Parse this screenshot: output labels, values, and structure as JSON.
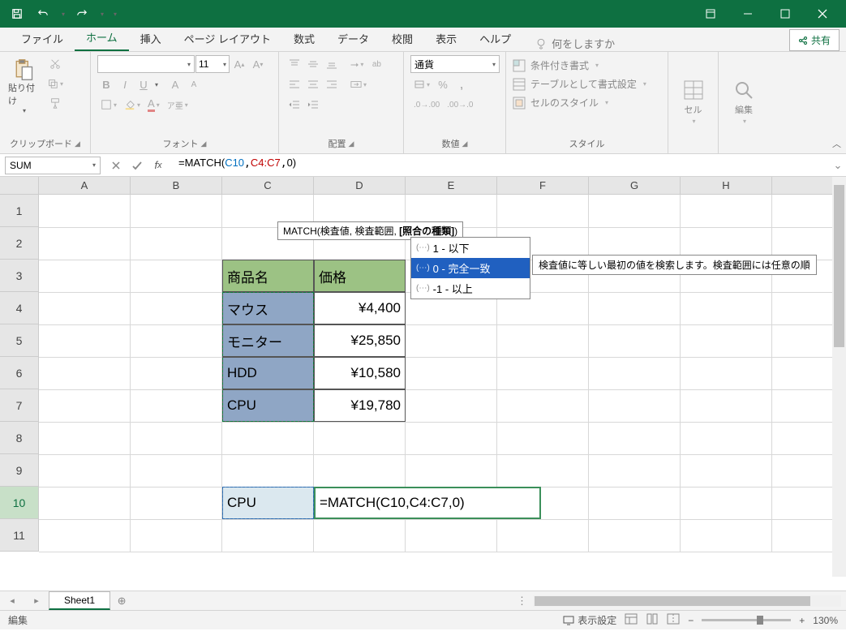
{
  "titlebar": {
    "save": "save",
    "undo": "undo",
    "redo": "redo"
  },
  "tabs": {
    "file": "ファイル",
    "home": "ホーム",
    "insert": "挿入",
    "pagelayout": "ページ レイアウト",
    "formulas": "数式",
    "data": "データ",
    "review": "校閲",
    "view": "表示",
    "help": "ヘルプ",
    "tellme": "何をしますか",
    "share": "共有"
  },
  "ribbon": {
    "clipboard": {
      "paste": "貼り付け",
      "label": "クリップボード"
    },
    "font": {
      "label": "フォント",
      "size": "11",
      "bold": "B",
      "italic": "I",
      "underline": "U"
    },
    "align": {
      "label": "配置"
    },
    "number": {
      "label": "数値",
      "format": "通貨"
    },
    "styles": {
      "label": "スタイル",
      "cond": "条件付き書式",
      "table": "テーブルとして書式設定",
      "cell": "セルのスタイル"
    },
    "cells": {
      "label": "セル"
    },
    "editing": {
      "label": "編集"
    }
  },
  "formulabar": {
    "namebox": "SUM",
    "formula_prefix": "=MATCH(",
    "arg1": "C10",
    "arg2": "C4:C7",
    "arg3": "0",
    "formula_suffix": ")"
  },
  "columns": [
    "A",
    "B",
    "C",
    "D",
    "E",
    "F",
    "G",
    "H"
  ],
  "rows": [
    "1",
    "2",
    "3",
    "4",
    "5",
    "6",
    "7",
    "8",
    "9",
    "10",
    "11"
  ],
  "data": {
    "c3": "商品名",
    "d3": "価格",
    "c4": "マウス",
    "d4": "¥4,400",
    "c5": "モニター",
    "d5": "¥25,850",
    "c6": "HDD",
    "d6": "¥10,580",
    "c7": "CPU",
    "d7": "¥19,780",
    "c10": "CPU",
    "d10": "=MATCH(C10,C4:C7,0)"
  },
  "tooltip": {
    "sig_fn": "MATCH(",
    "sig_a1": "検査値, ",
    "sig_a2": "検査範囲, ",
    "sig_a3": "[照合の種類]",
    "sig_end": ")",
    "opt1": "1 - 以下",
    "opt2": "0 - 完全一致",
    "opt3": "-1 - 以上",
    "desc": "検査値に等しい最初の値を検索します。検査範囲には任意の順"
  },
  "sheets": {
    "sheet1": "Sheet1"
  },
  "status": {
    "mode": "編集",
    "display": "表示設定",
    "zoom": "130%"
  }
}
